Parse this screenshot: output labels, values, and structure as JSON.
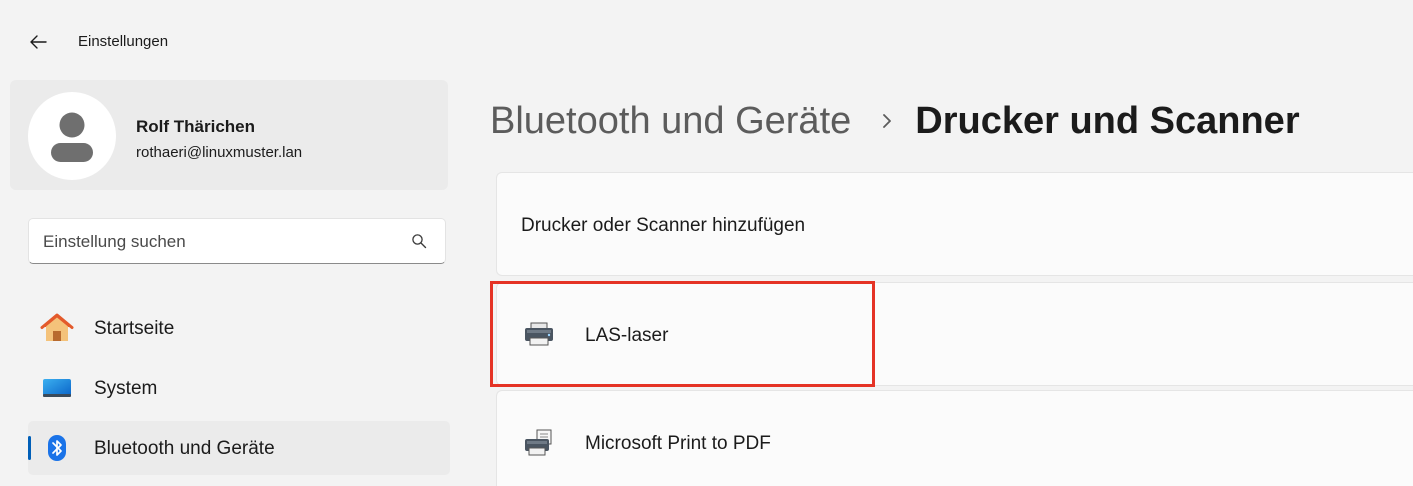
{
  "window": {
    "title": "Einstellungen"
  },
  "profile": {
    "name": "Rolf Thärichen",
    "email": "rothaeri@linuxmuster.lan"
  },
  "search": {
    "placeholder": "Einstellung suchen"
  },
  "nav": {
    "items": [
      {
        "label": "Startseite",
        "icon": "home-icon",
        "selected": false
      },
      {
        "label": "System",
        "icon": "system-icon",
        "selected": false
      },
      {
        "label": "Bluetooth und Geräte",
        "icon": "bluetooth-icon",
        "selected": true
      }
    ]
  },
  "breadcrumb": {
    "parent": "Bluetooth und Geräte",
    "current": "Drucker und Scanner"
  },
  "main": {
    "add_label": "Drucker oder Scanner hinzufügen",
    "printers": [
      {
        "name": "LAS-laser",
        "icon": "printer-icon",
        "highlighted": true
      },
      {
        "name": "Microsoft Print to PDF",
        "icon": "pdf-printer-icon",
        "highlighted": false
      }
    ]
  },
  "colors": {
    "accent": "#005fb8",
    "highlight": "#e53325",
    "background": "#f3f3f3",
    "card": "#fbfbfb"
  }
}
